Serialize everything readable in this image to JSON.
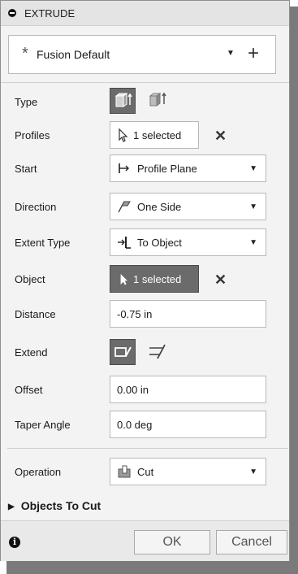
{
  "dialog": {
    "title": "EXTRUDE"
  },
  "preset": {
    "icon": "star-icon",
    "name": "Fusion Default",
    "add_label": "+"
  },
  "labels": {
    "type": "Type",
    "profiles": "Profiles",
    "start": "Start",
    "direction": "Direction",
    "extent_type": "Extent Type",
    "object": "Object",
    "distance": "Distance",
    "extend": "Extend",
    "offset": "Offset",
    "taper_angle": "Taper Angle",
    "operation": "Operation"
  },
  "values": {
    "profiles": "1 selected",
    "start": "Profile Plane",
    "direction": "One Side",
    "extent_type": "To Object",
    "object": "1 selected",
    "distance": "-0.75 in",
    "offset": "0.00 in",
    "taper_angle": "0.0 deg",
    "operation": "Cut"
  },
  "clear_symbol": "✕",
  "section": {
    "objects_to_cut": "Objects To Cut"
  },
  "footer": {
    "ok": "OK",
    "cancel": "Cancel",
    "info_symbol": "i"
  },
  "colors": {
    "selected_bg": "#6b6b6b",
    "panel_bg": "#f3f3f3"
  }
}
